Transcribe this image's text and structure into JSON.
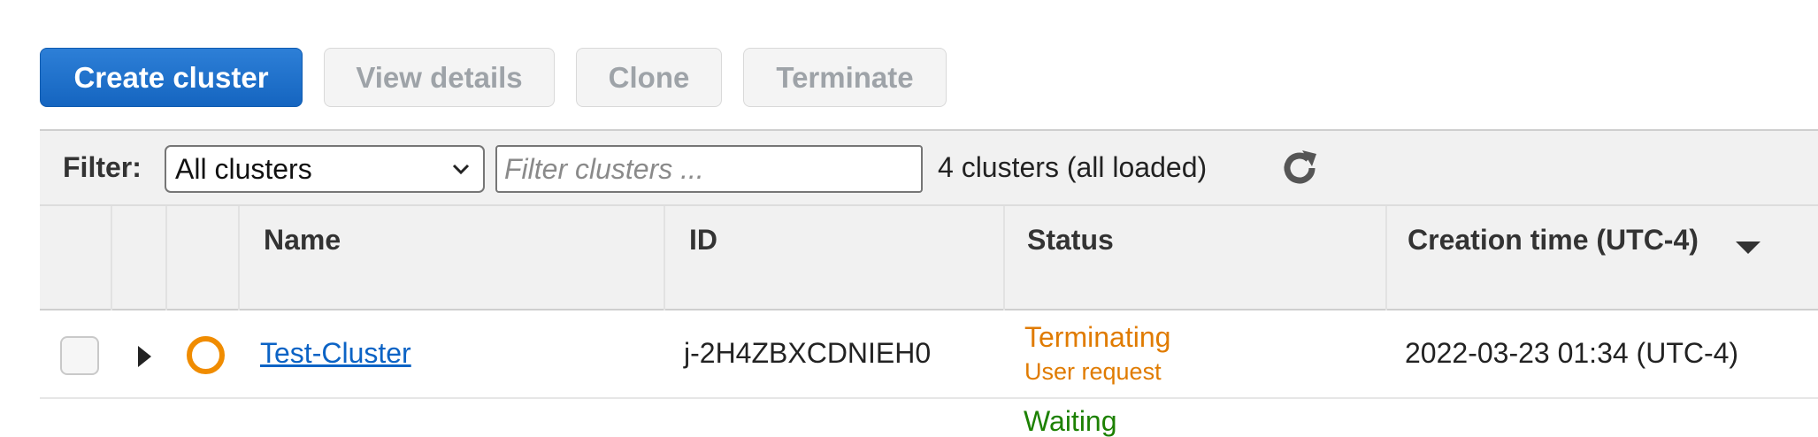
{
  "toolbar": {
    "create_label": "Create cluster",
    "view_details_label": "View details",
    "clone_label": "Clone",
    "terminate_label": "Terminate"
  },
  "filter": {
    "label": "Filter:",
    "select_value": "All clusters",
    "input_placeholder": "Filter clusters ...",
    "count_text": "4 clusters (all loaded)"
  },
  "table": {
    "headers": {
      "name": "Name",
      "id": "ID",
      "status": "Status",
      "creation_time": "Creation time (UTC-4)"
    },
    "rows": [
      {
        "name": "Test-Cluster",
        "id": "j-2H4ZBXCDNIEH0",
        "status": "Terminating",
        "status_detail": "User request",
        "creation_time": "2022-03-23 01:34 (UTC-4)"
      }
    ],
    "next_row_status_partial": "Waiting"
  },
  "colors": {
    "primary": "#1565c0",
    "terminating": "#e07b00",
    "waiting": "#1d8102",
    "link": "#0b63c5"
  },
  "icons": {
    "select_chevron": "chevron-down-icon",
    "refresh": "refresh-icon",
    "expand": "caret-right-icon",
    "status": "terminating-status-icon",
    "sort": "sort-descending-icon"
  }
}
